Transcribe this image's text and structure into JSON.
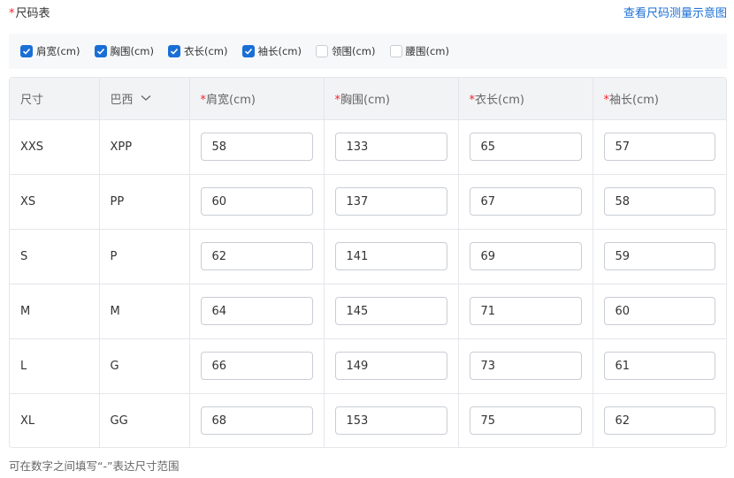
{
  "header": {
    "required_mark": "*",
    "title": "尺码表",
    "link": "查看尺码测量示意图"
  },
  "checkboxes": [
    {
      "label": "肩宽(cm)",
      "checked": true
    },
    {
      "label": "胸围(cm)",
      "checked": true
    },
    {
      "label": "衣长(cm)",
      "checked": true
    },
    {
      "label": "袖长(cm)",
      "checked": true
    },
    {
      "label": "领围(cm)",
      "checked": false
    },
    {
      "label": "腰围(cm)",
      "checked": false
    }
  ],
  "table": {
    "headers": {
      "size": "尺寸",
      "region": "巴西",
      "required_mark": "*",
      "shoulder": "肩宽(cm)",
      "chest": "胸围(cm)",
      "length": "衣长(cm)",
      "sleeve": "袖长(cm)"
    },
    "rows": [
      {
        "size": "XXS",
        "region": "XPP",
        "shoulder": "58",
        "chest": "133",
        "length": "65",
        "sleeve": "57"
      },
      {
        "size": "XS",
        "region": "PP",
        "shoulder": "60",
        "chest": "137",
        "length": "67",
        "sleeve": "58"
      },
      {
        "size": "S",
        "region": "P",
        "shoulder": "62",
        "chest": "141",
        "length": "69",
        "sleeve": "59"
      },
      {
        "size": "M",
        "region": "M",
        "shoulder": "64",
        "chest": "145",
        "length": "71",
        "sleeve": "60"
      },
      {
        "size": "L",
        "region": "G",
        "shoulder": "66",
        "chest": "149",
        "length": "73",
        "sleeve": "61"
      },
      {
        "size": "XL",
        "region": "GG",
        "shoulder": "68",
        "chest": "153",
        "length": "75",
        "sleeve": "62"
      }
    ]
  },
  "note": "可在数字之间填写“-”表达尺寸范围",
  "colors": {
    "accent": "#1a6fd6",
    "required": "#f5222d",
    "header_bg": "#f2f3f5",
    "bar_bg": "#f7f8fa"
  }
}
